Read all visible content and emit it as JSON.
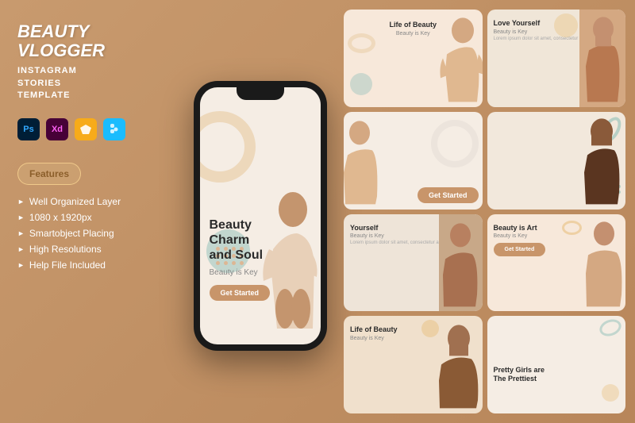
{
  "brand": {
    "title": "BEAUTY VLOGGER",
    "subtitle_line1": "INSTAGRAM",
    "subtitle_line2": "STORIES",
    "subtitle_line3": "TEMPLATE"
  },
  "tools": [
    {
      "name": "PS",
      "label": "Ps"
    },
    {
      "name": "XD",
      "label": "Xd"
    },
    {
      "name": "Sketch",
      "label": "Sk"
    },
    {
      "name": "Figma",
      "label": "Fi"
    }
  ],
  "features": {
    "section_label": "Features",
    "items": [
      "Well Organized Layer",
      "1080 x 1920px",
      "Smartobject Placing",
      "High Resolutions",
      "Help File Included"
    ]
  },
  "phone": {
    "main_title": "Beauty Charm\nand Soul",
    "subtitle": "Beauty is Key",
    "button_label": "Get Started"
  },
  "stories": [
    {
      "id": "card1",
      "title": "Life of Beauty",
      "subtitle": "Beauty is Key",
      "desc": "",
      "has_btn": false
    },
    {
      "id": "card2",
      "title": "Love Yourself",
      "subtitle": "Beauty is Key",
      "desc": "Lorem ipsum dolor sit amet, consectetur adipiscing elit..",
      "has_btn": false
    },
    {
      "id": "card3",
      "title": "",
      "subtitle": "",
      "desc": "",
      "has_btn": true,
      "btn_label": "Get Started"
    },
    {
      "id": "card4",
      "title": "",
      "subtitle": "",
      "desc": "",
      "has_btn": false
    },
    {
      "id": "card5",
      "title": "Yourself",
      "subtitle": "Beauty is Key",
      "desc": "Lorem ipsum dolor sit amet, consectetur adipiscing elit.",
      "has_btn": false
    },
    {
      "id": "card6",
      "title": "Beauty is Art",
      "subtitle": "Beauty is Key",
      "desc": "",
      "has_btn": true,
      "btn_label": "Get Started"
    },
    {
      "id": "card7",
      "title": "Life of Beauty",
      "subtitle": "Beauty is Key",
      "desc": "",
      "has_btn": false
    },
    {
      "id": "card8",
      "title": "Pretty Girls are\nThe Prettiest",
      "subtitle": "",
      "desc": "",
      "has_btn": false
    }
  ],
  "colors": {
    "bg": "#c89a6e",
    "accent": "#c8956a",
    "teal": "#8fbfb8",
    "cream": "#f5ede4",
    "text_dark": "#2a2a2a"
  }
}
